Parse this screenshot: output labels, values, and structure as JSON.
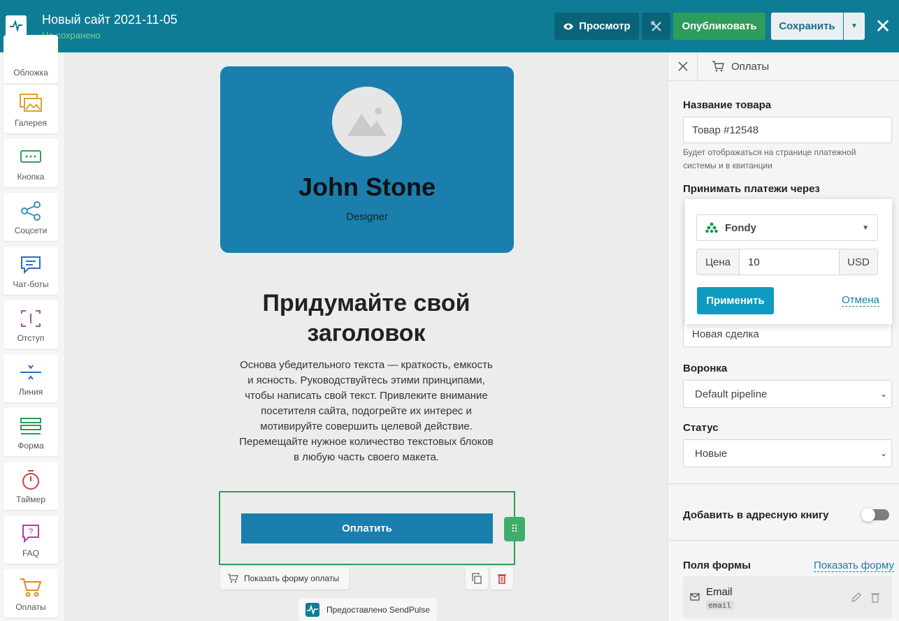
{
  "header": {
    "title": "Новый сайт 2021-11-05",
    "status": "Не сохранено",
    "preview_label": "Просмотр",
    "publish_label": "Опубликовать",
    "save_label": "Сохранить",
    "close_symbol": "✕"
  },
  "sidebar": {
    "items": [
      {
        "label": "Обложка",
        "icon": "cover-icon"
      },
      {
        "label": "Галерея",
        "icon": "gallery-icon"
      },
      {
        "label": "Кнопка",
        "icon": "button-icon"
      },
      {
        "label": "Соцсети",
        "icon": "share-icon"
      },
      {
        "label": "Чат-боты",
        "icon": "chat-icon"
      },
      {
        "label": "Отступ",
        "icon": "spacing-icon"
      },
      {
        "label": "Линия",
        "icon": "line-icon"
      },
      {
        "label": "Форма",
        "icon": "form-icon"
      },
      {
        "label": "Таймер",
        "icon": "timer-icon"
      },
      {
        "label": "FAQ",
        "icon": "faq-icon"
      },
      {
        "label": "Оплаты",
        "icon": "cart-icon"
      }
    ]
  },
  "canvas": {
    "card": {
      "name": "John Stone",
      "role": "Designer"
    },
    "headline": "Придумайте свой заголовок",
    "body": "Основа убедительного текста — краткость, емкость и ясность. Руководствуйтесь этими принципами, чтобы написать свой текст. Привлеките внимание посетителя сайта, подогрейте их интерес и мотивируйте совершить целевой действие. Перемещайте нужное количество текстовых блоков в любую часть своего макета.",
    "pay_button": "Оплатить",
    "show_pay_form": "Показать форму оплаты",
    "powered_by": "Предоставлено SendPulse"
  },
  "panel": {
    "breadcrumb": "Оплаты",
    "product_name_label": "Название товара",
    "product_name_value": "Товар #12548",
    "product_hint": "Будет отображаться на странице платежной системы и в квитанции",
    "accept_payments_label": "Принимать платежи через",
    "deal_value": "Новая сделка",
    "funnel_label": "Воронка",
    "funnel_value": "Default pipeline",
    "status_label": "Статус",
    "status_value": "Новые",
    "address_book_label": "Добавить в адресную книгу",
    "address_book_on": false,
    "form_fields_label": "Поля формы",
    "show_form_link": "Показать форму",
    "field_name": "Email",
    "field_key": "email"
  },
  "popover": {
    "provider": "Fondy",
    "price_label": "Цена",
    "price_value": "10",
    "currency": "USD",
    "apply_label": "Применить",
    "cancel_label": "Отмена"
  },
  "colors": {
    "header_bg": "#0f7c96",
    "publish_green": "#2e9c5a",
    "card_blue": "#1a7fad",
    "apply_blue": "#0f9bbf",
    "link_blue": "#1b7ea3"
  }
}
